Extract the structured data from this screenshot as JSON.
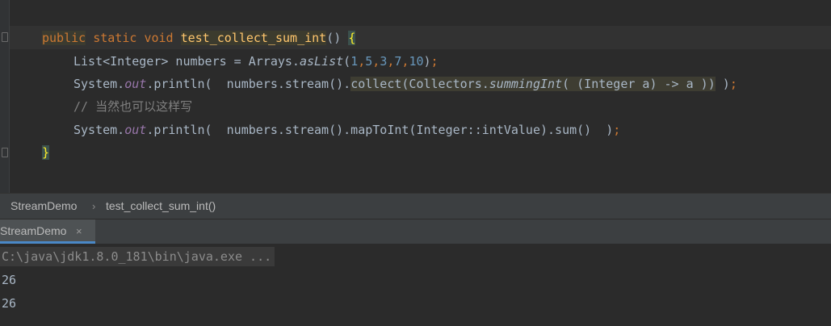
{
  "editor": {
    "line1": {
      "public": "public",
      "static": "static",
      "void": "void",
      "method": "test_collect_sum_int",
      "parens": "()",
      "brace": "{"
    },
    "line2": {
      "type": "List<Integer> numbers = Arrays.",
      "method": "asList",
      "open": "(",
      "n1": "1",
      "c1": ",",
      "n2": "5",
      "c2": ",",
      "n3": "3",
      "c3": ",",
      "n4": "7",
      "c4": ",",
      "n5": "10",
      "close": ")",
      "semi": ";"
    },
    "line3": {
      "sys": "System.",
      "out": "out",
      "print": ".println(  numbers.stream().",
      "collect": "collect(Collectors.",
      "summing": "summingInt",
      "lambda": "( (Integer a) -> a )",
      "close": ")",
      "tail": " )",
      "semi": ";"
    },
    "line4": {
      "comment": "// 当然也可以这样写"
    },
    "line5": {
      "sys": "System.",
      "out": "out",
      "rest": ".println(  numbers.stream().mapToInt(Integer::intValue).sum()  )",
      "semi": ";"
    },
    "line6": {
      "brace": "}"
    }
  },
  "breadcrumb": {
    "class_name": "StreamDemo",
    "separator": "›",
    "method_name": "test_collect_sum_int()"
  },
  "run_panel": {
    "tab_label": "StreamDemo",
    "close_glyph": "×"
  },
  "console": {
    "command": "C:\\java\\jdk1.8.0_181\\bin\\java.exe ...",
    "output": [
      "26",
      "26"
    ]
  }
}
